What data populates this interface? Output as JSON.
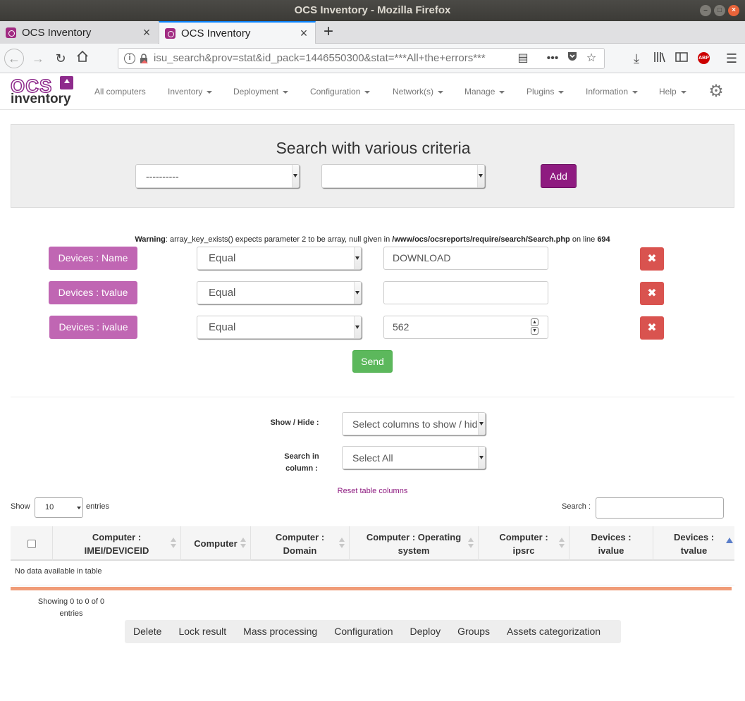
{
  "window": {
    "title": "OCS Inventory - Mozilla Firefox"
  },
  "tabs": [
    {
      "title": "OCS Inventory",
      "close": "×"
    },
    {
      "title": "OCS Inventory",
      "close": "×"
    }
  ],
  "new_tab": "+",
  "urlbar": {
    "url": "isu_search&prov=stat&id_pack=1446550300&stat=***All+the+errors***"
  },
  "brand": {
    "logo_top": "OCS",
    "logo_bottom": "inventory"
  },
  "menu": [
    {
      "label": "All computers"
    },
    {
      "label": "Inventory"
    },
    {
      "label": "Deployment"
    },
    {
      "label": "Configuration"
    },
    {
      "label": "Network(s)"
    },
    {
      "label": "Manage"
    },
    {
      "label": "Plugins"
    },
    {
      "label": "Information"
    },
    {
      "label": "Help"
    }
  ],
  "search": {
    "title": "Search with various criteria",
    "field_select": "----------",
    "operator_select": "",
    "add_label": "Add"
  },
  "warning": {
    "prefix": "Warning",
    "message": ": array_key_exists() expects parameter 2 to be array, null given in ",
    "path": "/www/ocs/ocsreports/require/search/Search.php",
    "online": " on line ",
    "line": "694"
  },
  "criteria": [
    {
      "label": "Devices : Name",
      "operator": "Equal",
      "value": "DOWNLOAD"
    },
    {
      "label": "Devices : tvalue",
      "operator": "Equal",
      "value": ""
    },
    {
      "label": "Devices : ivalue",
      "operator": "Equal",
      "value": "562"
    }
  ],
  "delete_symbol": "✖",
  "send_label": "Send",
  "controls": {
    "show_hide_label": "Show / Hide :",
    "show_hide_value": "Select columns to show / hide",
    "search_in_label": "Search in column :",
    "search_in_value": "Select All",
    "reset_label": "Reset table columns"
  },
  "table": {
    "show_label": "Show",
    "page_size": "10",
    "entries_label": "entries",
    "search_label": "Search :",
    "columns": [
      {
        "label": "Computer : IMEI/DEVICEID"
      },
      {
        "label": "Computer"
      },
      {
        "label": "Computer : Domain"
      },
      {
        "label": "Computer : Operating system"
      },
      {
        "label": "Computer : ipsrc"
      },
      {
        "label": "Devices : ivalue"
      },
      {
        "label": "Devices : tvalue"
      }
    ],
    "empty_message": "No data available in table",
    "info": "Showing 0 to 0 of 0 entries"
  },
  "actions": [
    {
      "label": "Delete"
    },
    {
      "label": "Lock result"
    },
    {
      "label": "Mass processing"
    },
    {
      "label": "Configuration"
    },
    {
      "label": "Deploy"
    },
    {
      "label": "Groups"
    },
    {
      "label": "Assets categorization"
    }
  ]
}
